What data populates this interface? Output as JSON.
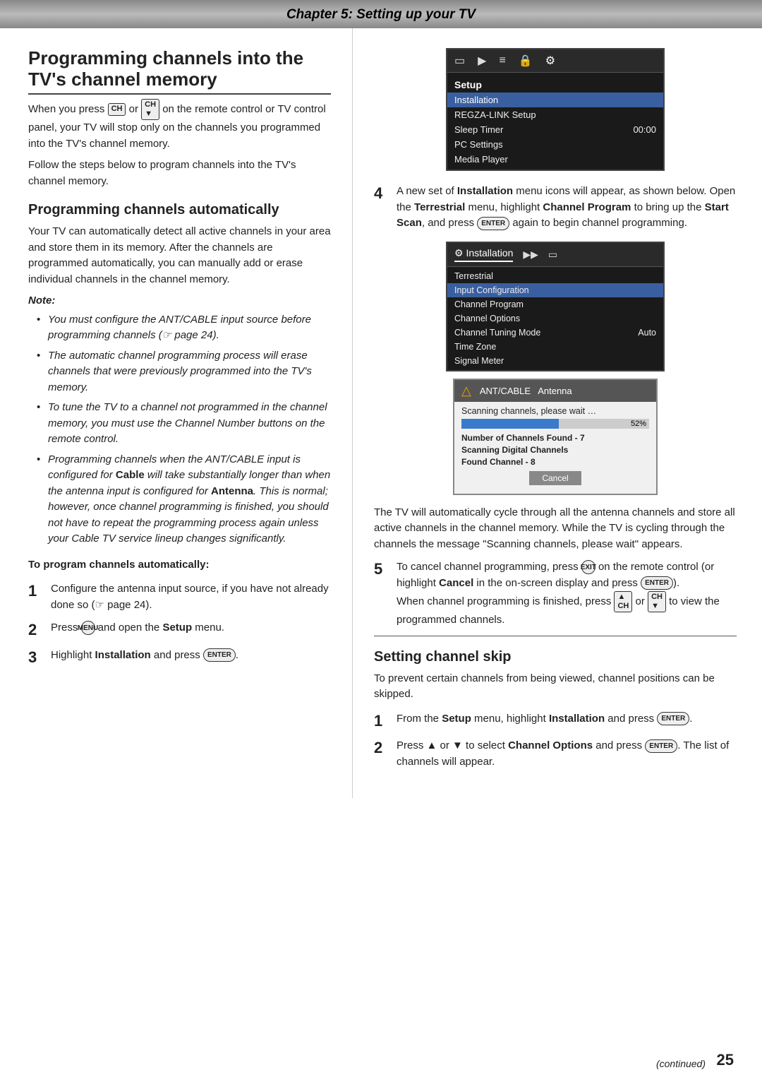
{
  "header": {
    "title": "Chapter 5: Setting up your TV"
  },
  "left": {
    "main_section_title": "Programming channels into the TV's channel memory",
    "intro_p1": "When you press  or  on the remote control or TV control panel, your TV will stop only on the channels you programmed into the TV's channel memory.",
    "intro_p2": "Follow the steps below to program channels into the TV's channel memory.",
    "sub_section_title": "Programming channels automatically",
    "auto_p1": "Your TV can automatically detect all active channels in your area and store them in its memory. After the channels are programmed automatically, you can manually add or erase individual channels in the channel memory.",
    "note_label": "Note:",
    "bullets": [
      "You must configure the ANT/CABLE input source before programming channels (☞ page 24).",
      "The automatic channel programming process will erase channels that were previously programmed into the TV's memory.",
      "To tune the TV to a channel not programmed in the channel memory, you must use the Channel Number buttons on the remote control.",
      "Programming channels when the ANT/CABLE input is configured for Cable will take substantially longer than when the antenna input is configured for Antenna. This is normal; however, once channel programming is finished, you should not have to repeat the programming process again unless your Cable TV service lineup changes significantly."
    ],
    "to_program_label": "To program channels automatically:",
    "steps": [
      {
        "num": "1",
        "text": "Configure the antenna input source, if you have not already done so (☞ page 24)."
      },
      {
        "num": "2",
        "text": "Press  and open the Setup menu."
      },
      {
        "num": "3",
        "text": "Highlight Installation and press ."
      }
    ]
  },
  "right": {
    "step4_text": "A new set of Installation menu icons will appear, as shown below. Open the Terrestrial menu, highlight Channel Program to bring up the Start Scan, and press  again to begin channel programming.",
    "step5_text": "To cancel channel programming, press  on the remote control (or highlight Cancel in the on-screen display and press ).",
    "step5b_text": "When channel programming is finished, press  or  to view the programmed channels.",
    "tv_screen": {
      "icons": [
        "monitor",
        "speaker",
        "settings",
        "lock",
        "gear"
      ],
      "active_icon": "gear",
      "rows": [
        {
          "label": "Setup",
          "value": "",
          "type": "header"
        },
        {
          "label": "Installation",
          "value": "",
          "type": "normal"
        },
        {
          "label": "REGZA-LINK Setup",
          "value": "",
          "type": "normal"
        },
        {
          "label": "Sleep Timer",
          "value": "00:00",
          "type": "normal"
        },
        {
          "label": "PC Settings",
          "value": "",
          "type": "normal"
        },
        {
          "label": "Media Player",
          "value": "",
          "type": "normal"
        }
      ]
    },
    "install_screen": {
      "rows": [
        {
          "label": "Terrestrial",
          "value": "",
          "type": "normal"
        },
        {
          "label": "Input Configuration",
          "value": "",
          "type": "selected"
        },
        {
          "label": "Channel Program",
          "value": "",
          "type": "normal"
        },
        {
          "label": "Channel Options",
          "value": "",
          "type": "normal"
        },
        {
          "label": "Channel Tuning Mode",
          "value": "Auto",
          "type": "normal"
        },
        {
          "label": "Time Zone",
          "value": "",
          "type": "normal"
        },
        {
          "label": "Signal Meter",
          "value": "",
          "type": "normal"
        }
      ]
    },
    "scan_dialog": {
      "header": "ANT/CABLE  Antenna",
      "subheader": "Scanning channels, please wait …",
      "progress": 52,
      "progress_label": "52%",
      "info_rows": [
        "Number of Channels Found - 7",
        "Scanning Digital Channels",
        "Found Channel - 8"
      ],
      "cancel_btn": "Cancel"
    },
    "cycle_text": "The TV will automatically cycle through all the antenna channels and store all active channels in the channel memory. While the TV is cycling through the channels the message \"Scanning channels, please wait\" appears.",
    "setting_skip_title": "Setting channel skip",
    "skip_intro": "To prevent certain channels from being viewed, channel positions can be skipped.",
    "skip_steps": [
      {
        "num": "1",
        "text": "From the Setup menu, highlight Installation and press ."
      },
      {
        "num": "2",
        "text": "Press ▲ or ▼ to select Channel Options and press . The list of channels will appear."
      }
    ]
  },
  "footer": {
    "continued": "(continued)",
    "page_number": "25"
  }
}
